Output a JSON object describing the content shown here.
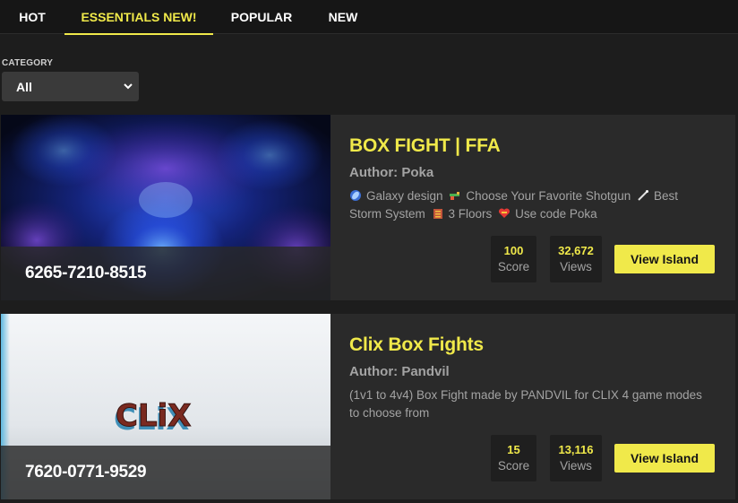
{
  "tabs": [
    {
      "label": "HOT"
    },
    {
      "label": "ESSENTIALS NEW!"
    },
    {
      "label": "POPULAR"
    },
    {
      "label": "NEW"
    }
  ],
  "filter": {
    "label": "CATEGORY",
    "selected": "All"
  },
  "islands": [
    {
      "title": "BOX FIGHT | FFA",
      "author": "Author: Poka",
      "code": "6265-7210-8515",
      "description": [
        {
          "icon": "galaxy-icon",
          "text": "Galaxy design"
        },
        {
          "icon": "shotgun-icon",
          "text": "Choose Your Favorite Shotgun"
        },
        {
          "icon": "wand-icon",
          "text": "Best Storm System"
        },
        {
          "icon": "floors-icon",
          "text": "3 Floors"
        },
        {
          "icon": "heart-icon",
          "text": "Use code Poka"
        }
      ],
      "score": "100",
      "score_label": "Score",
      "views": "32,672",
      "views_label": "Views",
      "button": "View Island"
    },
    {
      "title": "Clix Box Fights",
      "author": "Author: Pandvil",
      "code": "7620-0771-9529",
      "thumb_text": "CLiX",
      "description_text": "(1v1 to 4v4) Box Fight made by PANDVIL for CLIX 4 game modes to choose from",
      "score": "15",
      "score_label": "Score",
      "views": "13,116",
      "views_label": "Views",
      "button": "View Island"
    }
  ],
  "colors": {
    "accent": "#f0e94a",
    "background": "#1d1d1d",
    "card": "#2a2a2a",
    "muted_text": "#a3a3a3"
  }
}
